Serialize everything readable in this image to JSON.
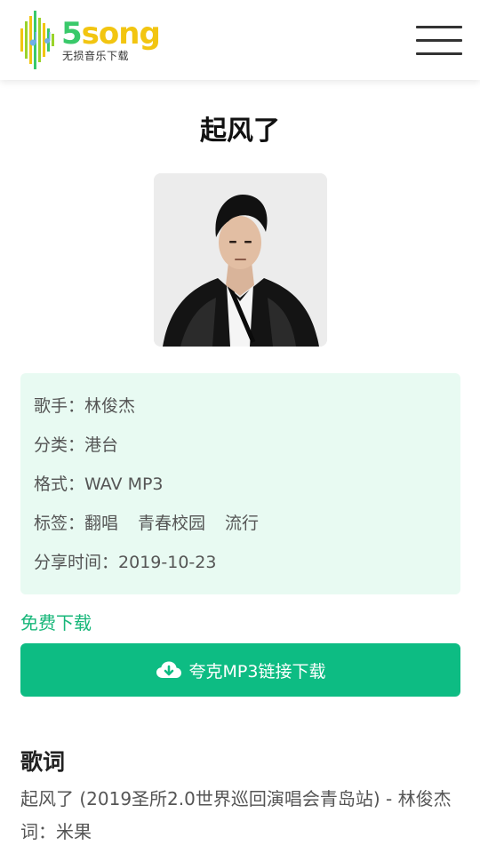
{
  "header": {
    "logo_number": "5",
    "logo_word": "song",
    "logo_subtitle": "无损音乐下载",
    "menu_icon": "hamburger-menu-icon"
  },
  "song": {
    "title": "起风了",
    "cover_image": "singer-portrait"
  },
  "info": {
    "singer_label": "歌手：",
    "singer": "林俊杰",
    "category_label": "分类：",
    "category": "港台",
    "format_label": "格式：",
    "format": "WAV MP3",
    "tags_label": "标签：",
    "tags": [
      "翻唱",
      "青春校园",
      "流行"
    ],
    "share_time_label": "分享时间：",
    "share_time": "2019-10-23"
  },
  "download": {
    "free_label": "免费下载",
    "button_label": "夸克MP3链接下载",
    "button_icon": "cloud-download-icon"
  },
  "lyrics": {
    "heading": "歌词",
    "lines": [
      "起风了 (2019圣所2.0世界巡回演唱会青岛站) - 林俊杰",
      "词：米果"
    ]
  },
  "colors": {
    "accent_green": "#0dbc83",
    "info_bg": "#e8faf2",
    "logo_green": "#39c96a",
    "logo_yellow": "#f2c511"
  }
}
